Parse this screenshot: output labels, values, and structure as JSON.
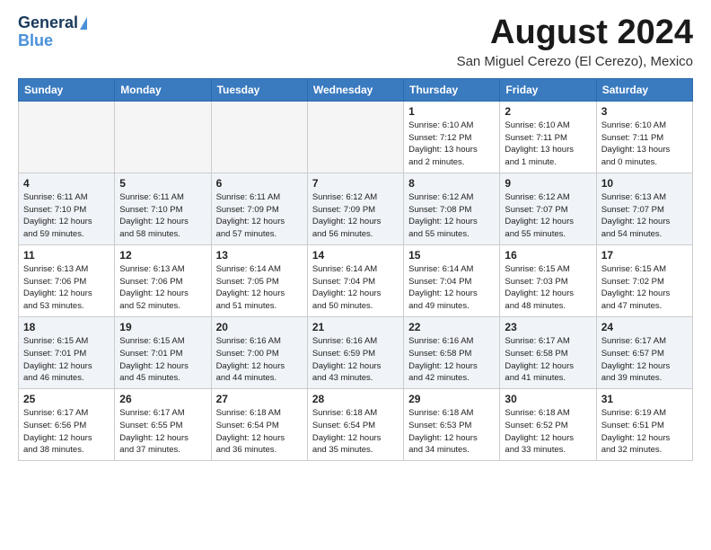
{
  "header": {
    "logo_line1": "General",
    "logo_line2": "Blue",
    "month_title": "August 2024",
    "subtitle": "San Miguel Cerezo (El Cerezo), Mexico"
  },
  "days_of_week": [
    "Sunday",
    "Monday",
    "Tuesday",
    "Wednesday",
    "Thursday",
    "Friday",
    "Saturday"
  ],
  "weeks": [
    [
      {
        "day": "",
        "info": ""
      },
      {
        "day": "",
        "info": ""
      },
      {
        "day": "",
        "info": ""
      },
      {
        "day": "",
        "info": ""
      },
      {
        "day": "1",
        "info": "Sunrise: 6:10 AM\nSunset: 7:12 PM\nDaylight: 13 hours\nand 2 minutes."
      },
      {
        "day": "2",
        "info": "Sunrise: 6:10 AM\nSunset: 7:11 PM\nDaylight: 13 hours\nand 1 minute."
      },
      {
        "day": "3",
        "info": "Sunrise: 6:10 AM\nSunset: 7:11 PM\nDaylight: 13 hours\nand 0 minutes."
      }
    ],
    [
      {
        "day": "4",
        "info": "Sunrise: 6:11 AM\nSunset: 7:10 PM\nDaylight: 12 hours\nand 59 minutes."
      },
      {
        "day": "5",
        "info": "Sunrise: 6:11 AM\nSunset: 7:10 PM\nDaylight: 12 hours\nand 58 minutes."
      },
      {
        "day": "6",
        "info": "Sunrise: 6:11 AM\nSunset: 7:09 PM\nDaylight: 12 hours\nand 57 minutes."
      },
      {
        "day": "7",
        "info": "Sunrise: 6:12 AM\nSunset: 7:09 PM\nDaylight: 12 hours\nand 56 minutes."
      },
      {
        "day": "8",
        "info": "Sunrise: 6:12 AM\nSunset: 7:08 PM\nDaylight: 12 hours\nand 55 minutes."
      },
      {
        "day": "9",
        "info": "Sunrise: 6:12 AM\nSunset: 7:07 PM\nDaylight: 12 hours\nand 55 minutes."
      },
      {
        "day": "10",
        "info": "Sunrise: 6:13 AM\nSunset: 7:07 PM\nDaylight: 12 hours\nand 54 minutes."
      }
    ],
    [
      {
        "day": "11",
        "info": "Sunrise: 6:13 AM\nSunset: 7:06 PM\nDaylight: 12 hours\nand 53 minutes."
      },
      {
        "day": "12",
        "info": "Sunrise: 6:13 AM\nSunset: 7:06 PM\nDaylight: 12 hours\nand 52 minutes."
      },
      {
        "day": "13",
        "info": "Sunrise: 6:14 AM\nSunset: 7:05 PM\nDaylight: 12 hours\nand 51 minutes."
      },
      {
        "day": "14",
        "info": "Sunrise: 6:14 AM\nSunset: 7:04 PM\nDaylight: 12 hours\nand 50 minutes."
      },
      {
        "day": "15",
        "info": "Sunrise: 6:14 AM\nSunset: 7:04 PM\nDaylight: 12 hours\nand 49 minutes."
      },
      {
        "day": "16",
        "info": "Sunrise: 6:15 AM\nSunset: 7:03 PM\nDaylight: 12 hours\nand 48 minutes."
      },
      {
        "day": "17",
        "info": "Sunrise: 6:15 AM\nSunset: 7:02 PM\nDaylight: 12 hours\nand 47 minutes."
      }
    ],
    [
      {
        "day": "18",
        "info": "Sunrise: 6:15 AM\nSunset: 7:01 PM\nDaylight: 12 hours\nand 46 minutes."
      },
      {
        "day": "19",
        "info": "Sunrise: 6:15 AM\nSunset: 7:01 PM\nDaylight: 12 hours\nand 45 minutes."
      },
      {
        "day": "20",
        "info": "Sunrise: 6:16 AM\nSunset: 7:00 PM\nDaylight: 12 hours\nand 44 minutes."
      },
      {
        "day": "21",
        "info": "Sunrise: 6:16 AM\nSunset: 6:59 PM\nDaylight: 12 hours\nand 43 minutes."
      },
      {
        "day": "22",
        "info": "Sunrise: 6:16 AM\nSunset: 6:58 PM\nDaylight: 12 hours\nand 42 minutes."
      },
      {
        "day": "23",
        "info": "Sunrise: 6:17 AM\nSunset: 6:58 PM\nDaylight: 12 hours\nand 41 minutes."
      },
      {
        "day": "24",
        "info": "Sunrise: 6:17 AM\nSunset: 6:57 PM\nDaylight: 12 hours\nand 39 minutes."
      }
    ],
    [
      {
        "day": "25",
        "info": "Sunrise: 6:17 AM\nSunset: 6:56 PM\nDaylight: 12 hours\nand 38 minutes."
      },
      {
        "day": "26",
        "info": "Sunrise: 6:17 AM\nSunset: 6:55 PM\nDaylight: 12 hours\nand 37 minutes."
      },
      {
        "day": "27",
        "info": "Sunrise: 6:18 AM\nSunset: 6:54 PM\nDaylight: 12 hours\nand 36 minutes."
      },
      {
        "day": "28",
        "info": "Sunrise: 6:18 AM\nSunset: 6:54 PM\nDaylight: 12 hours\nand 35 minutes."
      },
      {
        "day": "29",
        "info": "Sunrise: 6:18 AM\nSunset: 6:53 PM\nDaylight: 12 hours\nand 34 minutes."
      },
      {
        "day": "30",
        "info": "Sunrise: 6:18 AM\nSunset: 6:52 PM\nDaylight: 12 hours\nand 33 minutes."
      },
      {
        "day": "31",
        "info": "Sunrise: 6:19 AM\nSunset: 6:51 PM\nDaylight: 12 hours\nand 32 minutes."
      }
    ]
  ]
}
